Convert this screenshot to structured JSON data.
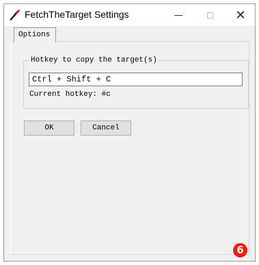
{
  "window": {
    "title": "FetchTheTarget Settings",
    "icon": "feather-pen-icon"
  },
  "tabs": [
    {
      "label": "Options",
      "selected": true
    }
  ],
  "group": {
    "label": "Hotkey to copy the target(s)"
  },
  "hotkey_input": {
    "value": "Ctrl + Shift + C"
  },
  "current_hotkey": "Current hotkey: #c",
  "buttons": {
    "ok": "OK",
    "cancel": "Cancel"
  },
  "annotation": {
    "number": "6",
    "color": "#e8200f"
  },
  "caption_buttons": {
    "close": "✕"
  }
}
